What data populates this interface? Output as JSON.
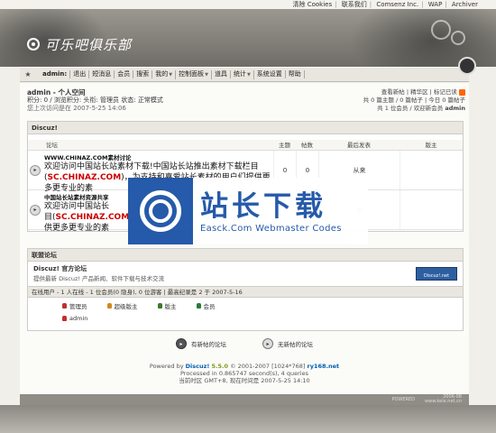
{
  "top_links": [
    "清除 Cookies",
    "联系我们",
    "Comsenz Inc.",
    "WAP",
    "Archiver"
  ],
  "logo": {
    "text": "可乐吧俱乐部"
  },
  "nav": {
    "user": "admin:",
    "items": [
      "退出",
      "短消息",
      "会员",
      "搜索",
      "我的",
      "控制面板",
      "道具",
      "统计",
      "系统设置",
      "帮助"
    ],
    "dropdown_flags": [
      false,
      false,
      false,
      false,
      true,
      true,
      false,
      true,
      false,
      false
    ]
  },
  "userinfo": {
    "line1": "admin - 个人空间",
    "line2": "积分: 0 / 浏览积分: 头衔: 管理员 状态: 正常模式",
    "line3": "您上次访问是在 2007-5-25 14:06"
  },
  "rightinfo": {
    "line1": "查看新帖 | 精华区 | 标记已读",
    "line2": "共 0 篇主题 / 0 篇帖子 | 今日 0 篇帖子",
    "line3": "共 1 位会员 / 欢迎新会员",
    "newest_member": "admin"
  },
  "category": {
    "title": "Discuz!",
    "headers": {
      "forum": "论坛",
      "topics": "主题",
      "posts": "帖数",
      "last": "最后发表",
      "mods": "版主"
    },
    "forums": [
      {
        "name": "WWW.CHINAZ.COM素材讨论",
        "desc_pre": "欢迎访问中国站长站素材下载!中国站长站推出素材下载栏目(",
        "desc_red": "SC.CHINAZ.COM",
        "desc_post": ")，为支持和喜爱站长素材的用户们提供更多更专业的素",
        "topics": "0",
        "posts": "0",
        "last": "从来"
      },
      {
        "name": "中国站长站素材资源共享",
        "desc_pre": "欢迎访问中国站长",
        "desc_red": "SC.CHINAZ.COM",
        "desc_post": "供更多更专业的素",
        "topics": "",
        "posts": "",
        "last": "来"
      }
    ]
  },
  "friends": {
    "title": "联盟论坛",
    "name": "Discuz! 官方论坛",
    "desc": "提供最新 Discuz! 产品新闻、软件下载与技术交流",
    "badge": "Discuz!.net"
  },
  "online": {
    "text": "在线用户 - 1 人在线 - 1 位会员(0 隐身), 0 位游客 | 最高纪录是 2 于 2007-5-16",
    "legend": [
      "管理员",
      "超级版主",
      "版主",
      "会员"
    ],
    "legend_colors": [
      "#c03030",
      "#d08a20",
      "#3a7a2a",
      "#2a7a3a"
    ],
    "users": [
      "admin"
    ]
  },
  "icon_legend": [
    "有新帖的论坛",
    "无新帖的论坛"
  ],
  "footer": {
    "powered_prefix": "Powered by",
    "brand": "Discuz!",
    "version": "5.5.0",
    "copyright": "© 2001-2007 [1024*768]",
    "site": "ry168.net",
    "processed": "Processed in 0.865747 second(s), 4 queries",
    "time": "当前时区 GMT+8, 现在时间是 2007-5-25 14:10"
  },
  "bottom": {
    "left": "POWERED",
    "right_line1": "2006-08",
    "right_line2": "www.kele.net.cn"
  },
  "watermark": {
    "big": "站长下载",
    "small": "Easck.Com Webmaster Codes"
  }
}
